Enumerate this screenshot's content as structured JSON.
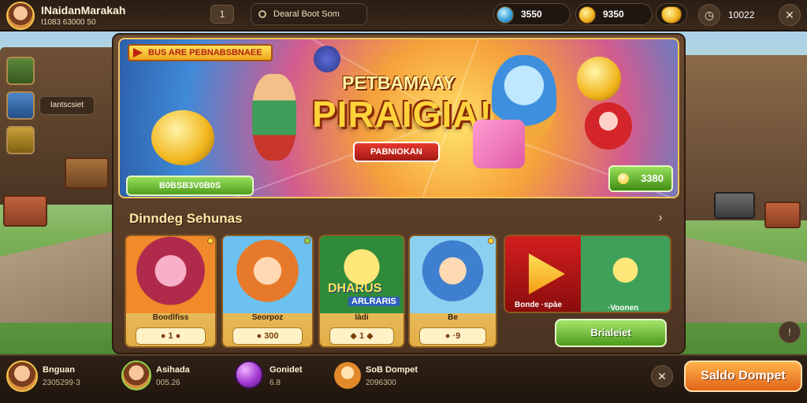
{
  "header": {
    "title": "INaidanMarakah",
    "subtitle": "I1083 63000 50",
    "search_placeholder": "Dearal Boot Som",
    "level_button": "1",
    "currencies": [
      {
        "icon": "compass-coin-icon",
        "value": "3550"
      },
      {
        "icon": "gold-coin-icon",
        "value": "9350"
      },
      {
        "icon": "gold-bag-icon",
        "value": ""
      }
    ],
    "timer": "10022"
  },
  "left_rail": {
    "label": "Iаntscsiet"
  },
  "banner": {
    "tag": "BUS ARE PEBNABSBNAEE",
    "title_small": "PETBAMAAY",
    "title": "PIRAIGIA!",
    "ribbon": "PABNIOKAN",
    "progress_label": "B0BSB3V0B0S",
    "price": "3380"
  },
  "section": {
    "title": "Dinndeg Sehunas",
    "arrow": "›"
  },
  "cards": [
    {
      "label": "Boodlfiss",
      "pill": "● 1 ●"
    },
    {
      "label": "Seorpoz",
      "pill": "● 300"
    },
    {
      "label": "Iàdi",
      "pill": "◆ 1 ◆",
      "art_text_1": "DHARUS",
      "art_text_2": "ARLRARIS"
    },
    {
      "label": "Be",
      "pill": "● ·9"
    }
  ],
  "wide_card": {
    "label_left": "Bonde ·spàe",
    "label_right": "·Voonen"
  },
  "green_button": "Brialeiet",
  "side_button": "!",
  "bottom": {
    "items": [
      {
        "title": "Bnguan",
        "sub": "2305299·3"
      },
      {
        "title": "Asihada",
        "sub": "005.26"
      },
      {
        "title": "Gonidet",
        "sub": "6.8"
      },
      {
        "title": "SoB Dompet",
        "sub": "2096300"
      }
    ],
    "close": "✕",
    "saldo_button": "Saldo Dompet"
  }
}
